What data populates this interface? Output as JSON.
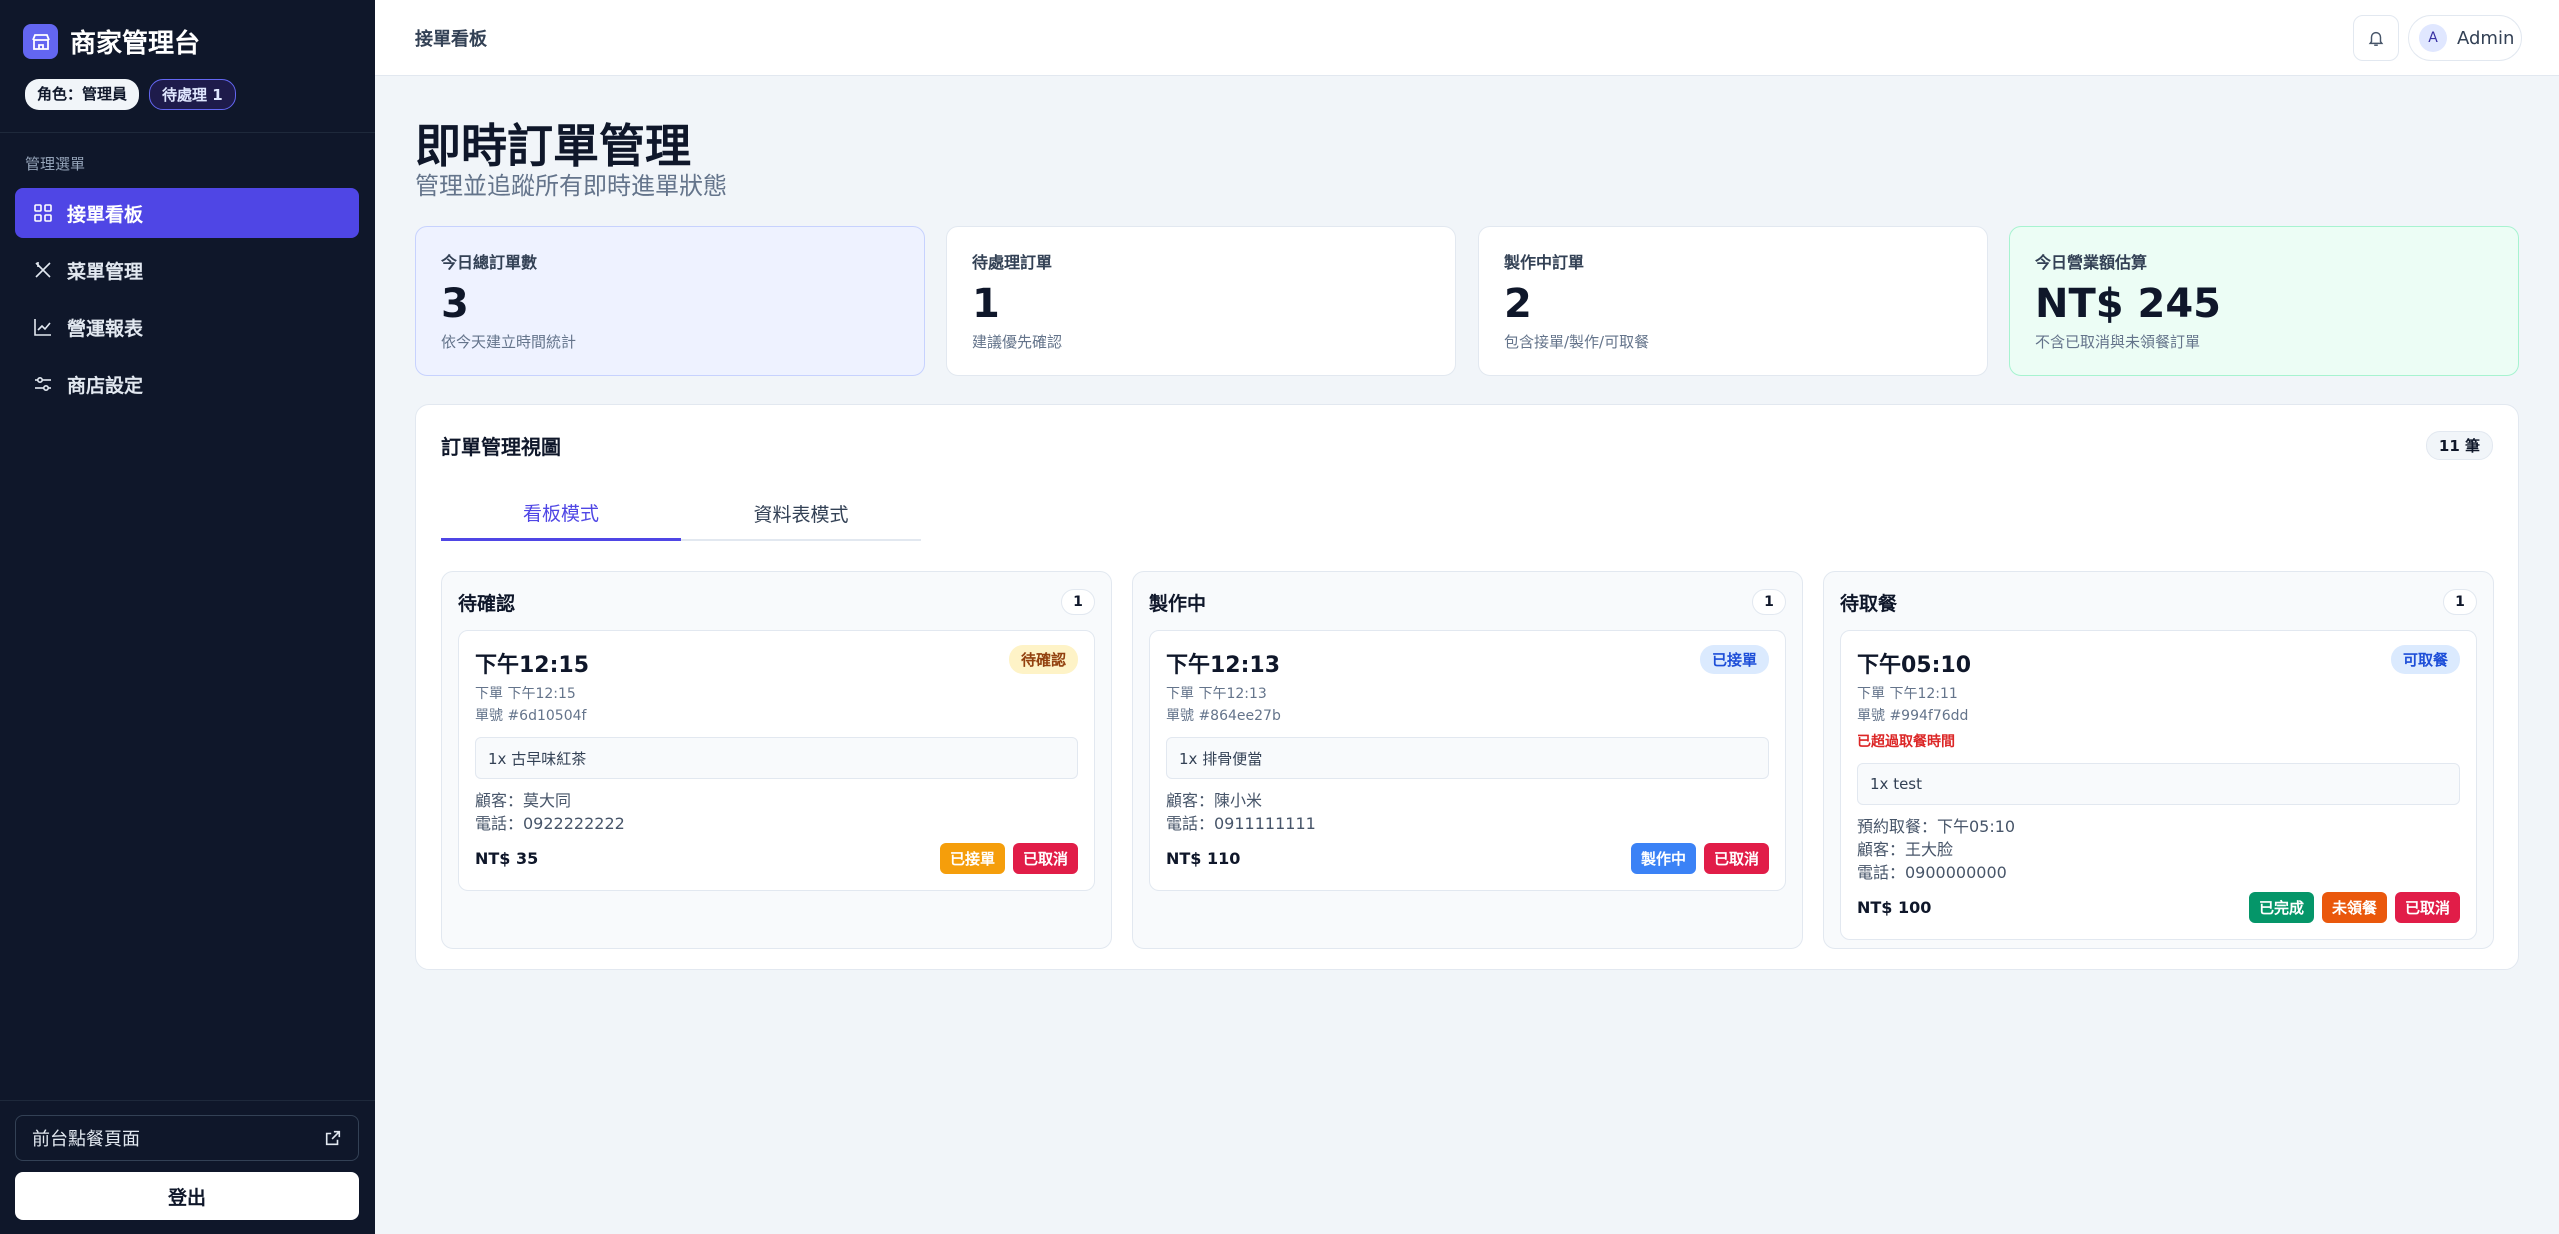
{
  "sidebar": {
    "brand": "商家管理台",
    "role_badge": "角色：管理員",
    "pending_badge": "待處理 1",
    "menu_heading": "管理選單",
    "items": [
      "接單看板",
      "菜單管理",
      "營運報表",
      "商店設定"
    ],
    "front_link": "前台點餐頁面",
    "logout": "登出"
  },
  "topbar": {
    "breadcrumb": "接單看板",
    "avatar_letter": "A",
    "user": "Admin"
  },
  "page": {
    "title": "即時訂單管理",
    "subtitle": "管理並追蹤所有即時進單狀態"
  },
  "stats": [
    {
      "label": "今日總訂單數",
      "value": "3",
      "note": "依今天建立時間統計"
    },
    {
      "label": "待處理訂單",
      "value": "1",
      "note": "建議優先確認"
    },
    {
      "label": "製作中訂單",
      "value": "2",
      "note": "包含接單/製作/可取餐"
    },
    {
      "label": "今日營業額估算",
      "value": "NT$ 245",
      "note": "不含已取消與未領餐訂單"
    }
  ],
  "panel": {
    "title": "訂單管理視圖",
    "count": "11 筆",
    "tabs": [
      "看板模式",
      "資料表模式"
    ]
  },
  "columns": [
    {
      "title": "待確認",
      "count": "1",
      "card": {
        "time": "下午12:15",
        "status": "待確認",
        "placed": "下單 下午12:15",
        "order_no": "單號 #6d10504f",
        "item": "1x 古早味紅茶",
        "customer": "顧客：莫大同",
        "phone": "電話：0922222222",
        "price": "NT$ 35",
        "buttons": [
          "已接單",
          "已取消"
        ]
      }
    },
    {
      "title": "製作中",
      "count": "1",
      "card": {
        "time": "下午12:13",
        "status": "已接單",
        "placed": "下單 下午12:13",
        "order_no": "單號 #864ee27b",
        "item": "1x 排骨便當",
        "customer": "顧客：陳小米",
        "phone": "電話：0911111111",
        "price": "NT$ 110",
        "buttons": [
          "製作中",
          "已取消"
        ]
      }
    },
    {
      "title": "待取餐",
      "count": "1",
      "card": {
        "time": "下午05:10",
        "status": "可取餐",
        "placed": "下單 下午12:11",
        "order_no": "單號 #994f76dd",
        "warning": "已超過取餐時間",
        "item": "1x test",
        "pickup": "預約取餐：下午05:10",
        "customer": "顧客：王大脸",
        "phone": "電話：0900000000",
        "price": "NT$ 100",
        "buttons": [
          "已完成",
          "未領餐",
          "已取消"
        ]
      }
    }
  ],
  "colors": {
    "accent": "#4f46e5",
    "sidebar_bg": "#0f172a"
  }
}
